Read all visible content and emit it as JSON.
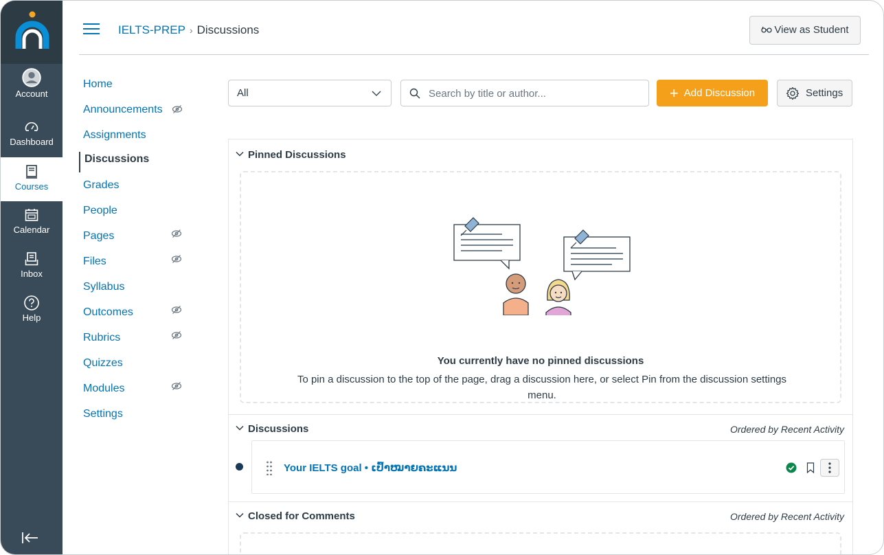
{
  "global_nav": {
    "items": [
      {
        "label": "Account",
        "icon": "account-icon"
      },
      {
        "label": "Dashboard",
        "icon": "dashboard-icon"
      },
      {
        "label": "Courses",
        "icon": "courses-icon"
      },
      {
        "label": "Calendar",
        "icon": "calendar-icon"
      },
      {
        "label": "Inbox",
        "icon": "inbox-icon"
      },
      {
        "label": "Help",
        "icon": "help-icon"
      }
    ],
    "active": "Courses"
  },
  "header": {
    "course": "IELTS-PREP",
    "separator": "›",
    "page": "Discussions",
    "view_as_student": "View as Student"
  },
  "course_nav": {
    "items": [
      {
        "label": "Home",
        "hidden": false
      },
      {
        "label": "Announcements",
        "hidden": true
      },
      {
        "label": "Assignments",
        "hidden": false
      },
      {
        "label": "Discussions",
        "hidden": false,
        "active": true
      },
      {
        "label": "Grades",
        "hidden": false
      },
      {
        "label": "People",
        "hidden": false
      },
      {
        "label": "Pages",
        "hidden": true
      },
      {
        "label": "Files",
        "hidden": true
      },
      {
        "label": "Syllabus",
        "hidden": false
      },
      {
        "label": "Outcomes",
        "hidden": true
      },
      {
        "label": "Rubrics",
        "hidden": true
      },
      {
        "label": "Quizzes",
        "hidden": false
      },
      {
        "label": "Modules",
        "hidden": true
      },
      {
        "label": "Settings",
        "hidden": false
      }
    ]
  },
  "toolbar": {
    "filter_value": "All",
    "search_placeholder": "Search by title or author...",
    "add_label": "Add Discussion",
    "settings_label": "Settings"
  },
  "pinned": {
    "title": "Pinned Discussions",
    "empty_title": "You currently have no pinned discussions",
    "empty_text": "To pin a discussion to the top of the page, drag a discussion here, or select Pin from the discussion settings menu."
  },
  "discussions": {
    "title": "Discussions",
    "ordered": "Ordered by Recent Activity",
    "items": [
      {
        "title": "Your IELTS goal • ເປົ້າໝາຍຄະແນນ",
        "unread": true,
        "published": true
      }
    ]
  },
  "closed": {
    "title": "Closed for Comments",
    "ordered": "Ordered by Recent Activity"
  },
  "colors": {
    "brand_blue": "#0374b5",
    "add_button": "#f5a01a",
    "nav_bg": "#394b58",
    "published_green": "#0b874b"
  }
}
